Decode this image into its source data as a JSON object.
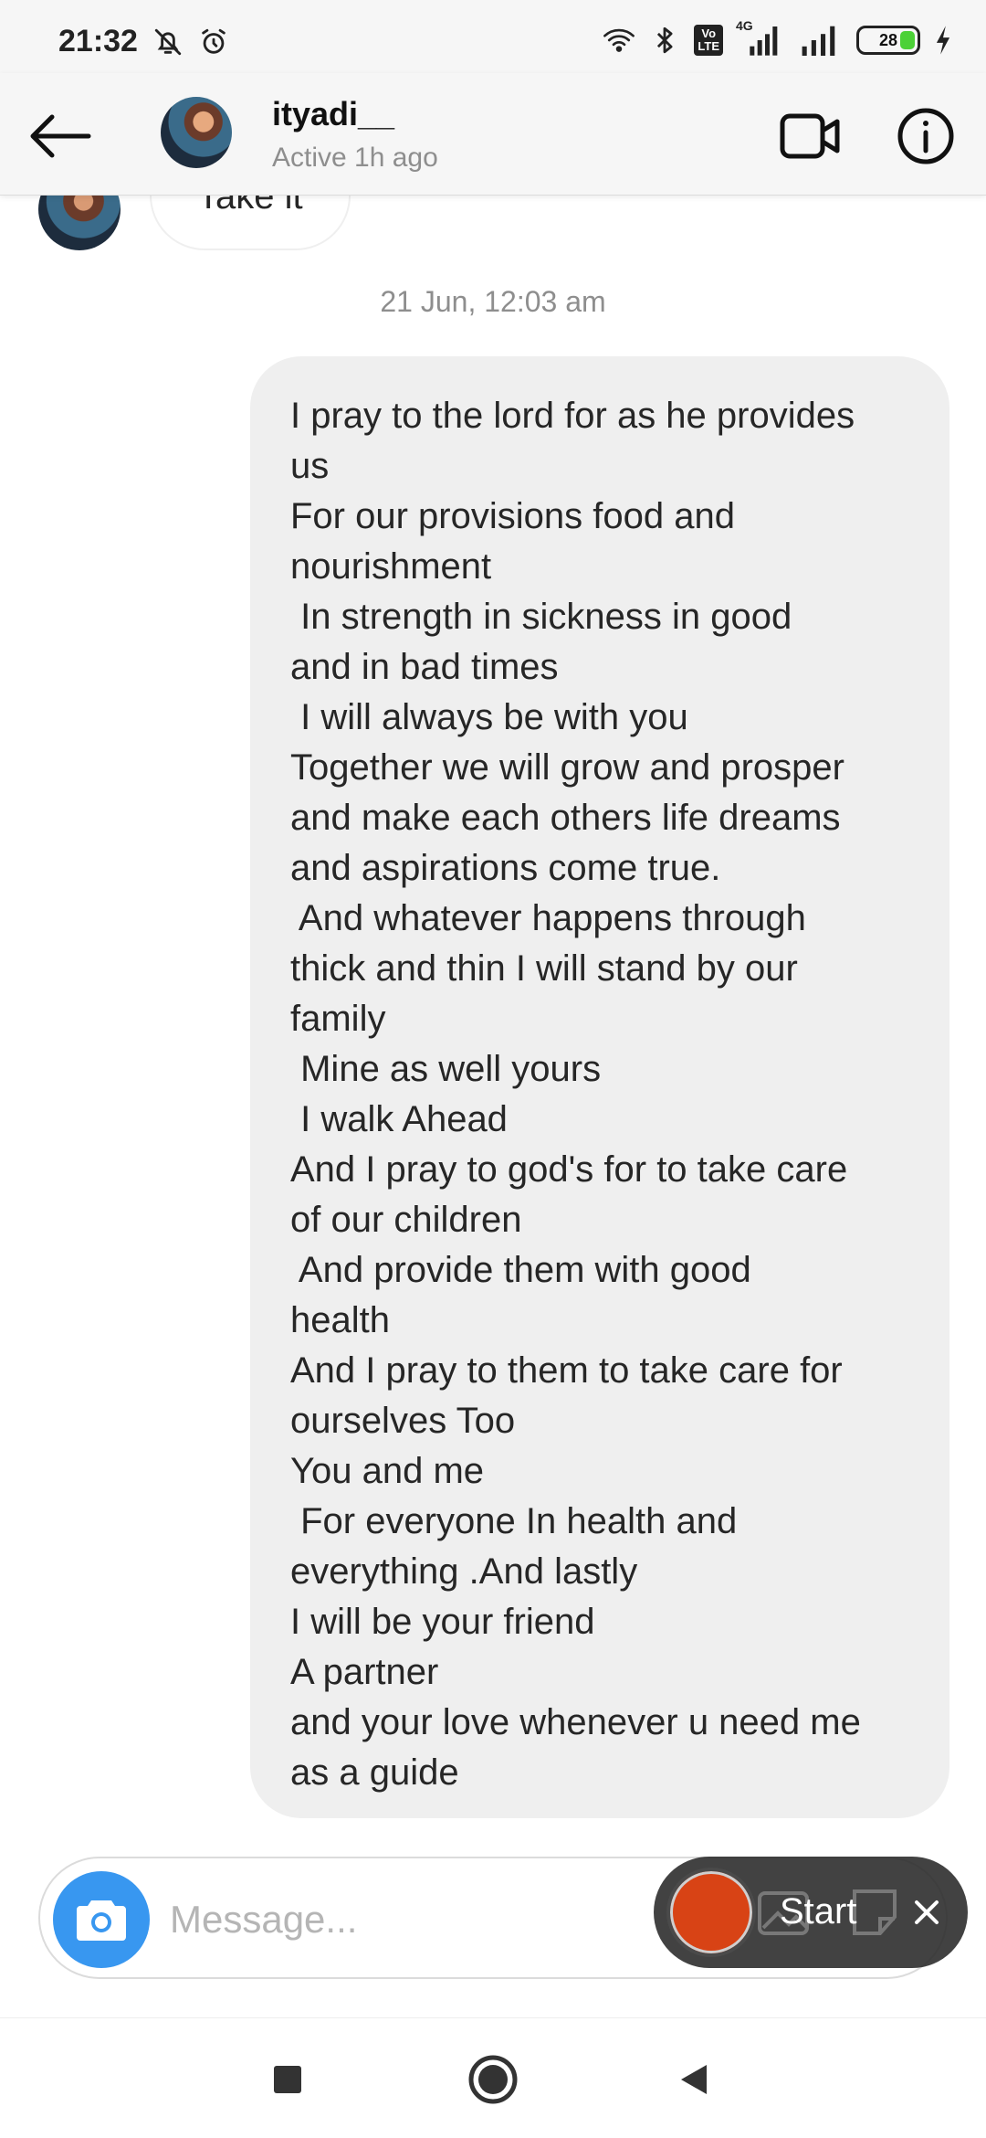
{
  "status_bar": {
    "time": "21:32",
    "network_label": "4G",
    "volte_label": "Vo\nLTE",
    "battery": "28",
    "battery_level": 28
  },
  "header": {
    "username": "ityadi__",
    "status": "Active 1h ago"
  },
  "chat": {
    "previous_message": "Take it",
    "timestamp": "21 Jun, 12:03 am",
    "message_lines": [
      "I pray to the lord for as he provides",
      "us",
      "For our provisions food and",
      "nourishment",
      " In strength in sickness in good",
      "and in bad times",
      " I will always be with you",
      "Together we will grow and prosper",
      "and make each others life dreams",
      "and aspirations come true.",
      " And whatever happens through",
      "thick and thin I will stand by our",
      "family",
      " Mine as well yours",
      " I walk Ahead",
      "And I pray to god's for to take care",
      "of our children",
      " And provide them with good",
      "health",
      "And I pray to them to take care for",
      "ourselves Too",
      "You and me",
      " For everyone In health and",
      "everything .And lastly",
      "I will be your friend",
      "A partner",
      "and your love whenever u need me",
      "as a guide"
    ]
  },
  "composer": {
    "placeholder": "Message...",
    "value": ""
  },
  "recorder": {
    "start_label": "Start"
  },
  "colors": {
    "accent": "#3897f0",
    "record": "#d84315",
    "bubble": "#efefef"
  },
  "icons": [
    "bell-off-icon",
    "alarm-icon",
    "wifi-icon",
    "bluetooth-icon",
    "signal-icon",
    "battery-icon",
    "charging-icon",
    "back-arrow-icon",
    "video-call-icon",
    "info-icon",
    "camera-icon",
    "close-icon",
    "square-nav-icon",
    "home-nav-icon",
    "back-nav-icon"
  ]
}
